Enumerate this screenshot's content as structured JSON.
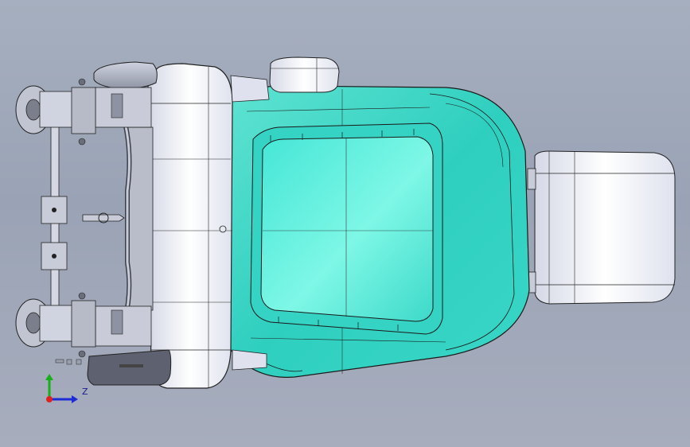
{
  "viewport": {
    "background_top": "#a6afbf",
    "background_bottom": "#a7adbd"
  },
  "model": {
    "seat_shell_color": "#3fd9c8",
    "seat_inner_color": "#5cf0dc",
    "plastic_color": "#eceef6",
    "dark_part_color": "#5b5f6b"
  },
  "triad": {
    "z_label": "Z",
    "x_axis_color": "#e02020",
    "y_axis_color": "#18b018",
    "z_axis_color": "#1b2bd6"
  }
}
